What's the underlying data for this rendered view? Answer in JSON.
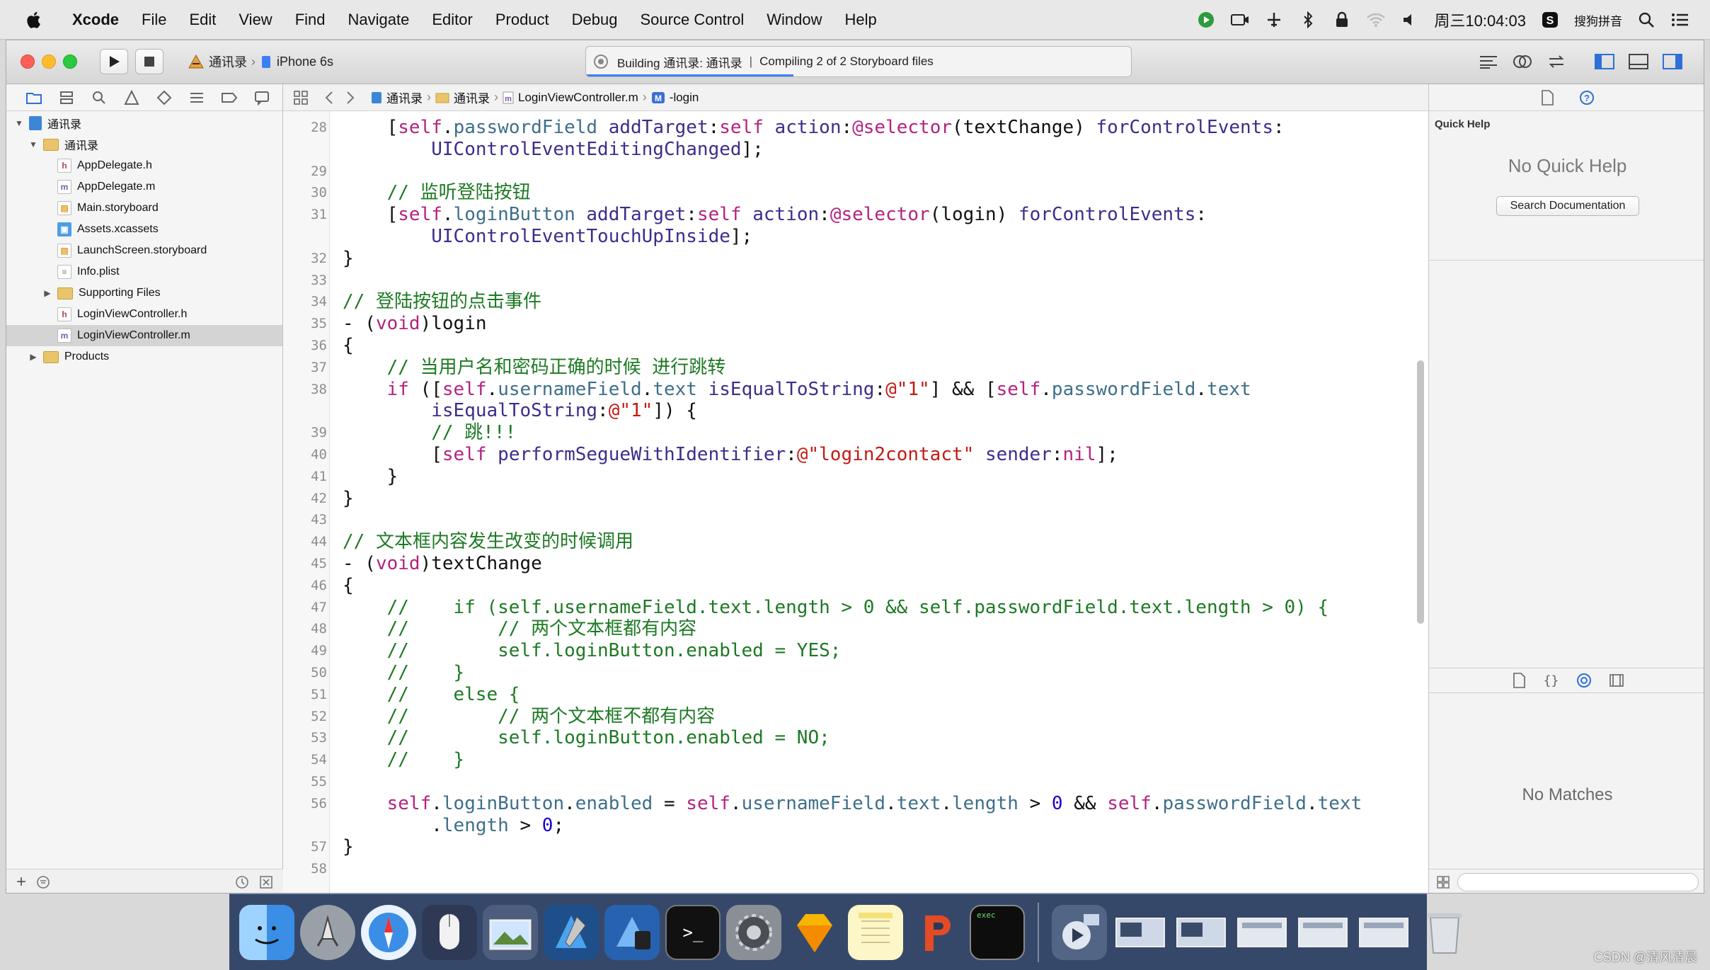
{
  "menubar": {
    "app": "Xcode",
    "items": [
      "File",
      "Edit",
      "View",
      "Find",
      "Navigate",
      "Editor",
      "Product",
      "Debug",
      "Source Control",
      "Window",
      "Help"
    ],
    "clock": "周三10:04:03",
    "input_method": "搜狗拼音"
  },
  "toolbar": {
    "scheme": "通讯录",
    "device": "iPhone 6s",
    "activity_building": "Building 通讯录: 通讯录",
    "activity_separator": "|",
    "activity_compiling": "Compiling 2 of 2 Storyboard files",
    "progress": 0.38
  },
  "navigator": {
    "project": "通讯录",
    "group": "通讯录",
    "files": [
      {
        "name": "AppDelegate.h",
        "icon": "h"
      },
      {
        "name": "AppDelegate.m",
        "icon": "m"
      },
      {
        "name": "Main.storyboard",
        "icon": "sb"
      },
      {
        "name": "Assets.xcassets",
        "icon": "xa"
      },
      {
        "name": "LaunchScreen.storyboard",
        "icon": "sb"
      },
      {
        "name": "Info.plist",
        "icon": "pl"
      },
      {
        "name": "Supporting Files",
        "icon": "folder"
      },
      {
        "name": "LoginViewController.h",
        "icon": "h"
      },
      {
        "name": "LoginViewController.m",
        "icon": "m"
      }
    ],
    "products": "Products",
    "selected_file": "LoginViewController.m"
  },
  "jumpbar": {
    "crumbs": [
      "通讯录",
      "通讯录",
      "LoginViewController.m",
      "-login"
    ]
  },
  "editor": {
    "line_numbers": [
      "28",
      "29",
      "30",
      "31",
      "32",
      "33",
      "34",
      "35",
      "36",
      "37",
      "38",
      "39",
      "40",
      "41",
      "42",
      "43",
      "44",
      "45",
      "46",
      "47",
      "48",
      "49",
      "50",
      "51",
      "52",
      "53",
      "54",
      "55",
      "56",
      "57",
      "58"
    ],
    "code_lines": [
      "    [self.passwordField addTarget:self action:@selector(textChange) forControlEvents:",
      "        UIControlEventEditingChanged];",
      "",
      "    // 监听登陆按钮",
      "    [self.loginButton addTarget:self action:@selector(login) forControlEvents:",
      "        UIControlEventTouchUpInside];",
      "}",
      "",
      "// 登陆按钮的点击事件",
      "- (void)login",
      "{",
      "    // 当用户名和密码正确的时候 进行跳转",
      "    if ([self.usernameField.text isEqualToString:@\"1\"] && [self.passwordField.text",
      "        isEqualToString:@\"1\"]) {",
      "        // 跳!!!",
      "        [self performSegueWithIdentifier:@\"login2contact\" sender:nil];",
      "    }",
      "}",
      "",
      "// 文本框内容发生改变的时候调用",
      "- (void)textChange",
      "{",
      "    //    if (self.usernameField.text.length > 0 && self.passwordField.text.length > 0) {",
      "    //        // 两个文本框都有内容",
      "    //        self.loginButton.enabled = YES;",
      "    //    }",
      "    //    else {",
      "    //        // 两个文本框不都有内容",
      "    //        self.loginButton.enabled = NO;",
      "    //    }",
      "",
      "    self.loginButton.enabled = self.usernameField.text.length > 0 && self.passwordField.text",
      "        .length > 0;",
      "}",
      ""
    ]
  },
  "utilities": {
    "quick_help_title": "Quick Help",
    "no_quick_help": "No Quick Help",
    "search_documentation": "Search Documentation",
    "no_matches": "No Matches"
  },
  "watermark": "CSDN @清风清晨",
  "colors": {
    "keyword": "#b4237f",
    "property": "#3e6f8a",
    "string": "#c41a16",
    "number": "#1c00cf",
    "comment": "#1e7a24",
    "project_member": "#3d6e85"
  }
}
